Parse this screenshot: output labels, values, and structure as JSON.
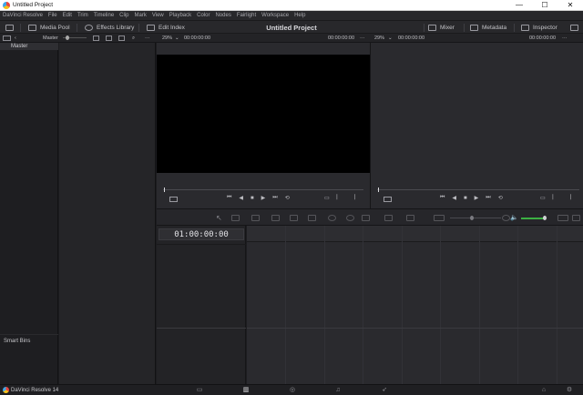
{
  "window": {
    "title": "Untitled Project",
    "minimize": "—",
    "maximize": "☐",
    "close": "✕"
  },
  "menu": [
    "DaVinci Resolve",
    "File",
    "Edit",
    "Trim",
    "Timeline",
    "Clip",
    "Mark",
    "View",
    "Playback",
    "Color",
    "Nodes",
    "Fairlight",
    "Workspace",
    "Help"
  ],
  "toolbar": {
    "media_pool": "Media Pool",
    "effects_library": "Effects Library",
    "edit_index": "Edit Index",
    "project_title": "Untitled Project",
    "mixer": "Mixer",
    "metadata": "Metadata",
    "inspector": "Inspector"
  },
  "subbar": {
    "bin_label": "Master",
    "src_zoom": "29%",
    "src_tc_left": "00:00:00:00",
    "src_tc_right": "00:00:00:00",
    "prg_zoom": "29%",
    "prg_tc_left": "00:00:00:00",
    "prg_tc_right": "00:00:00:00",
    "more": "···"
  },
  "bins": {
    "master": "Master",
    "smart_bins": "Smart Bins"
  },
  "timeline": {
    "timecode": "01:00:00:00"
  },
  "pagebar": {
    "brand": "DaVinci Resolve 14"
  },
  "colors": {
    "accent": "#e45a5a",
    "audio_level": "#3cb043",
    "bg": "#1c1c1f"
  }
}
